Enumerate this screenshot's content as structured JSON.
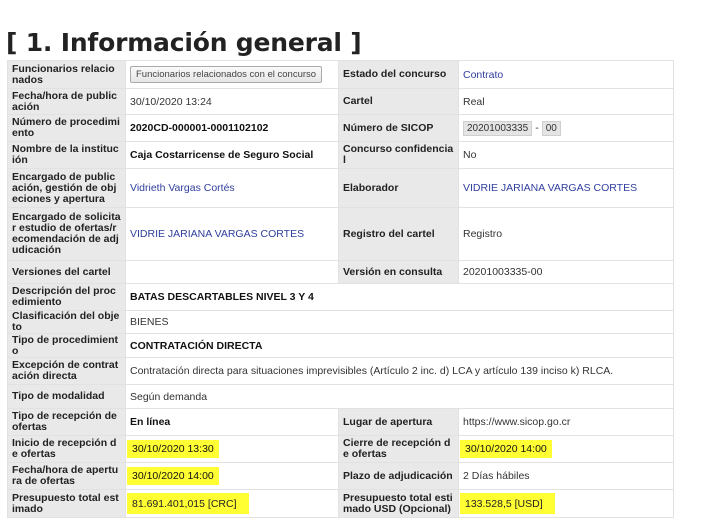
{
  "section_title": "[ 1. Información general ]",
  "rows": {
    "r1": {
      "l1": "Funcionarios relacionados",
      "btn": "Funcionarios relacionados con el concurso",
      "l2": "Estado del concurso",
      "v2": "Contrato"
    },
    "r2": {
      "l1": "Fecha/hora de publicación",
      "v1": "30/10/2020 13:24",
      "l2": "Cartel",
      "v2": "Real"
    },
    "r3": {
      "l1": "Número de procedimiento",
      "v1": "2020CD-000001-0001102102",
      "l2": "Número de SICOP",
      "sicop_num": "20201003335",
      "sicop_sep": "-",
      "sicop_ver": "00"
    },
    "r4": {
      "l1": "Nombre de la institución",
      "v1": "Caja Costarricense de Seguro Social",
      "l2": "Concurso confidencial",
      "v2": "No"
    },
    "r5": {
      "l1": "Encargado de publicación, gestión de objeciones y apertura",
      "v1": "Vidrieth Vargas Cortés",
      "l2": "Elaborador",
      "v2": "VIDRIE JARIANA VARGAS CORTES"
    },
    "r6": {
      "l1": "Encargado de solicitar estudio de ofertas/recomendación de adjudicación",
      "v1": "VIDRIE JARIANA VARGAS CORTES",
      "l2": "Registro del cartel",
      "v2": "Registro"
    },
    "r7": {
      "l1": "Versiones del cartel",
      "v1": "",
      "l2": "Versión en consulta",
      "v2": "20201003335-00"
    },
    "r8": {
      "l1": "Descripción del procedimiento",
      "v1": "BATAS DESCARTABLES NIVEL 3 Y 4"
    },
    "r9": {
      "l1": "Clasificación del objeto",
      "v1": "BIENES"
    },
    "r10": {
      "l1": "Tipo de procedimiento",
      "v1": "CONTRATACIÓN DIRECTA"
    },
    "r11": {
      "l1": "Excepción de contratación directa",
      "v1": "Contratación directa para situaciones imprevisibles (Artículo 2 inc. d) LCA y artículo 139 inciso k) RLCA."
    },
    "r12": {
      "l1": "Tipo de modalidad",
      "v1": "Según demanda"
    },
    "r13": {
      "l1": "Tipo de recepción de ofertas",
      "v1": "En línea",
      "l2": "Lugar de apertura",
      "v2": "https://www.sicop.go.cr"
    },
    "r14": {
      "l1": "Inicio de recepción de ofertas",
      "v1": "30/10/2020 13:30",
      "l2": "Cierre de recepción de ofertas",
      "v2": "30/10/2020 14:00"
    },
    "r15": {
      "l1": "Fecha/hora de apertura de ofertas",
      "v1": "30/10/2020 14:00",
      "l2": "Plazo de adjudicación",
      "v2": "2 Días hábiles"
    },
    "r16": {
      "l1": "Presupuesto total estimado",
      "v1": "81.691.401,015 [CRC]",
      "l2": "Presupuesto total estimado USD (Opcional)",
      "v2": "133.528,5 [USD]"
    }
  },
  "colors": {
    "highlight": "#ffff33",
    "link": "#2f3e9e",
    "label_bg": "#e9e9e9"
  }
}
